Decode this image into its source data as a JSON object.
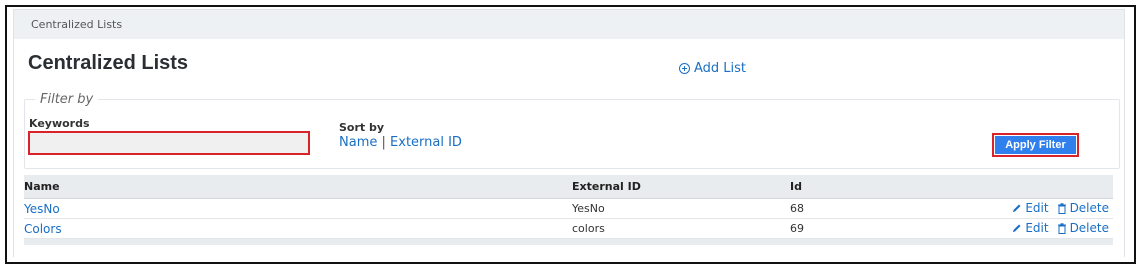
{
  "panel": {
    "header_title": "Centralized Lists"
  },
  "page": {
    "title": "Centralized Lists",
    "add_list_label": "Add List"
  },
  "filter": {
    "legend": "Filter by",
    "keywords_label": "Keywords",
    "keywords_value": "",
    "sort_by_label": "Sort by",
    "sort_options": [
      "Name",
      "External ID"
    ],
    "sort_separator": "|",
    "apply_label": "Apply Filter"
  },
  "table": {
    "columns": [
      "Name",
      "External ID",
      "Id"
    ],
    "rows": [
      {
        "name": "YesNo",
        "external_id": "YesNo",
        "id": "68",
        "edit": "Edit",
        "delete": "Delete"
      },
      {
        "name": "Colors",
        "external_id": "colors",
        "id": "69",
        "edit": "Edit",
        "delete": "Delete"
      }
    ]
  },
  "colors": {
    "link": "#1a6fc4",
    "button": "#2f80ed",
    "highlight_border": "#d9222a",
    "header_bg": "#e9ecef"
  },
  "icons": {
    "add": "plus-circle-icon",
    "edit": "pencil-icon",
    "delete": "trash-icon"
  }
}
